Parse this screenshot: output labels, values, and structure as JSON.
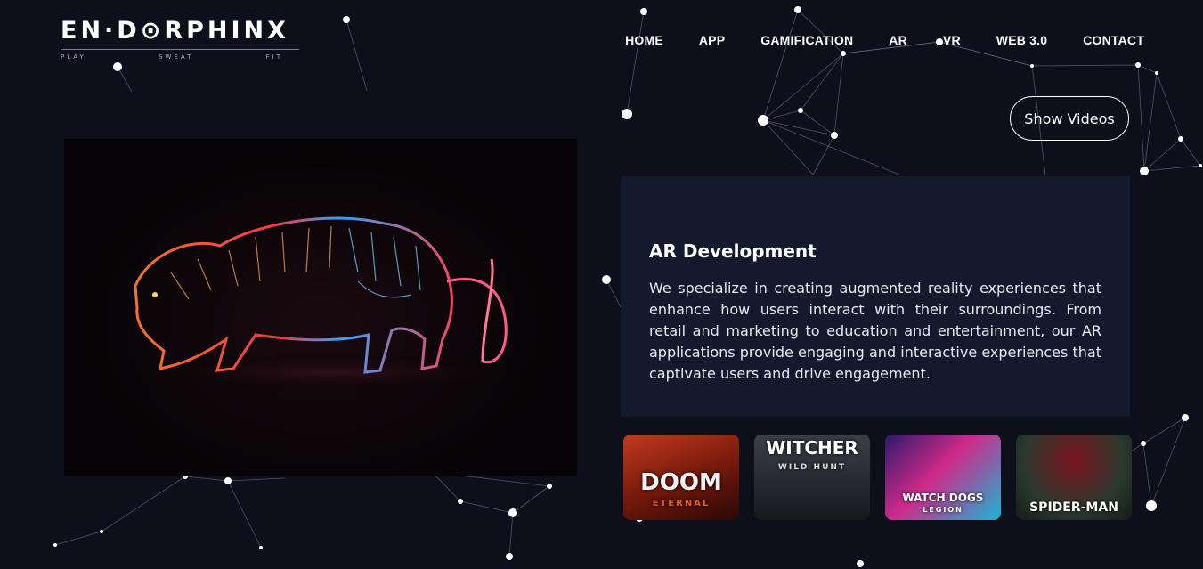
{
  "logo": {
    "wordmark": "EN·D⊙RPHINX",
    "tagline": [
      "PLAY",
      "SWEAT",
      "FIT"
    ]
  },
  "nav": {
    "items": [
      {
        "label": "HOME"
      },
      {
        "label": "APP"
      },
      {
        "label": "GAMIFICATION"
      },
      {
        "label": "AR"
      },
      {
        "label": "VR"
      },
      {
        "label": "WEB 3.0"
      },
      {
        "label": "CONTACT"
      }
    ]
  },
  "show_videos_label": "Show Videos",
  "hero_image": {
    "subject": "neon tiger"
  },
  "card": {
    "title": "AR Development",
    "body": "We specialize in creating augmented reality experiences that enhance how users interact with their surroundings. From retail and marketing to education and entertainment, our AR applications provide engaging and interactive experiences that captivate users and drive engagement."
  },
  "games": [
    {
      "title": "DOOM",
      "subtitle": "ETERNAL"
    },
    {
      "title": "WITCHER",
      "subtitle": "WILD HUNT"
    },
    {
      "title": "WATCH DOGS",
      "subtitle": "LEGION"
    },
    {
      "title": "SPIDER-MAN",
      "subtitle": ""
    }
  ],
  "colors": {
    "background": "#0d0f1a",
    "card": "#131a2e",
    "text": "#ffffff"
  }
}
